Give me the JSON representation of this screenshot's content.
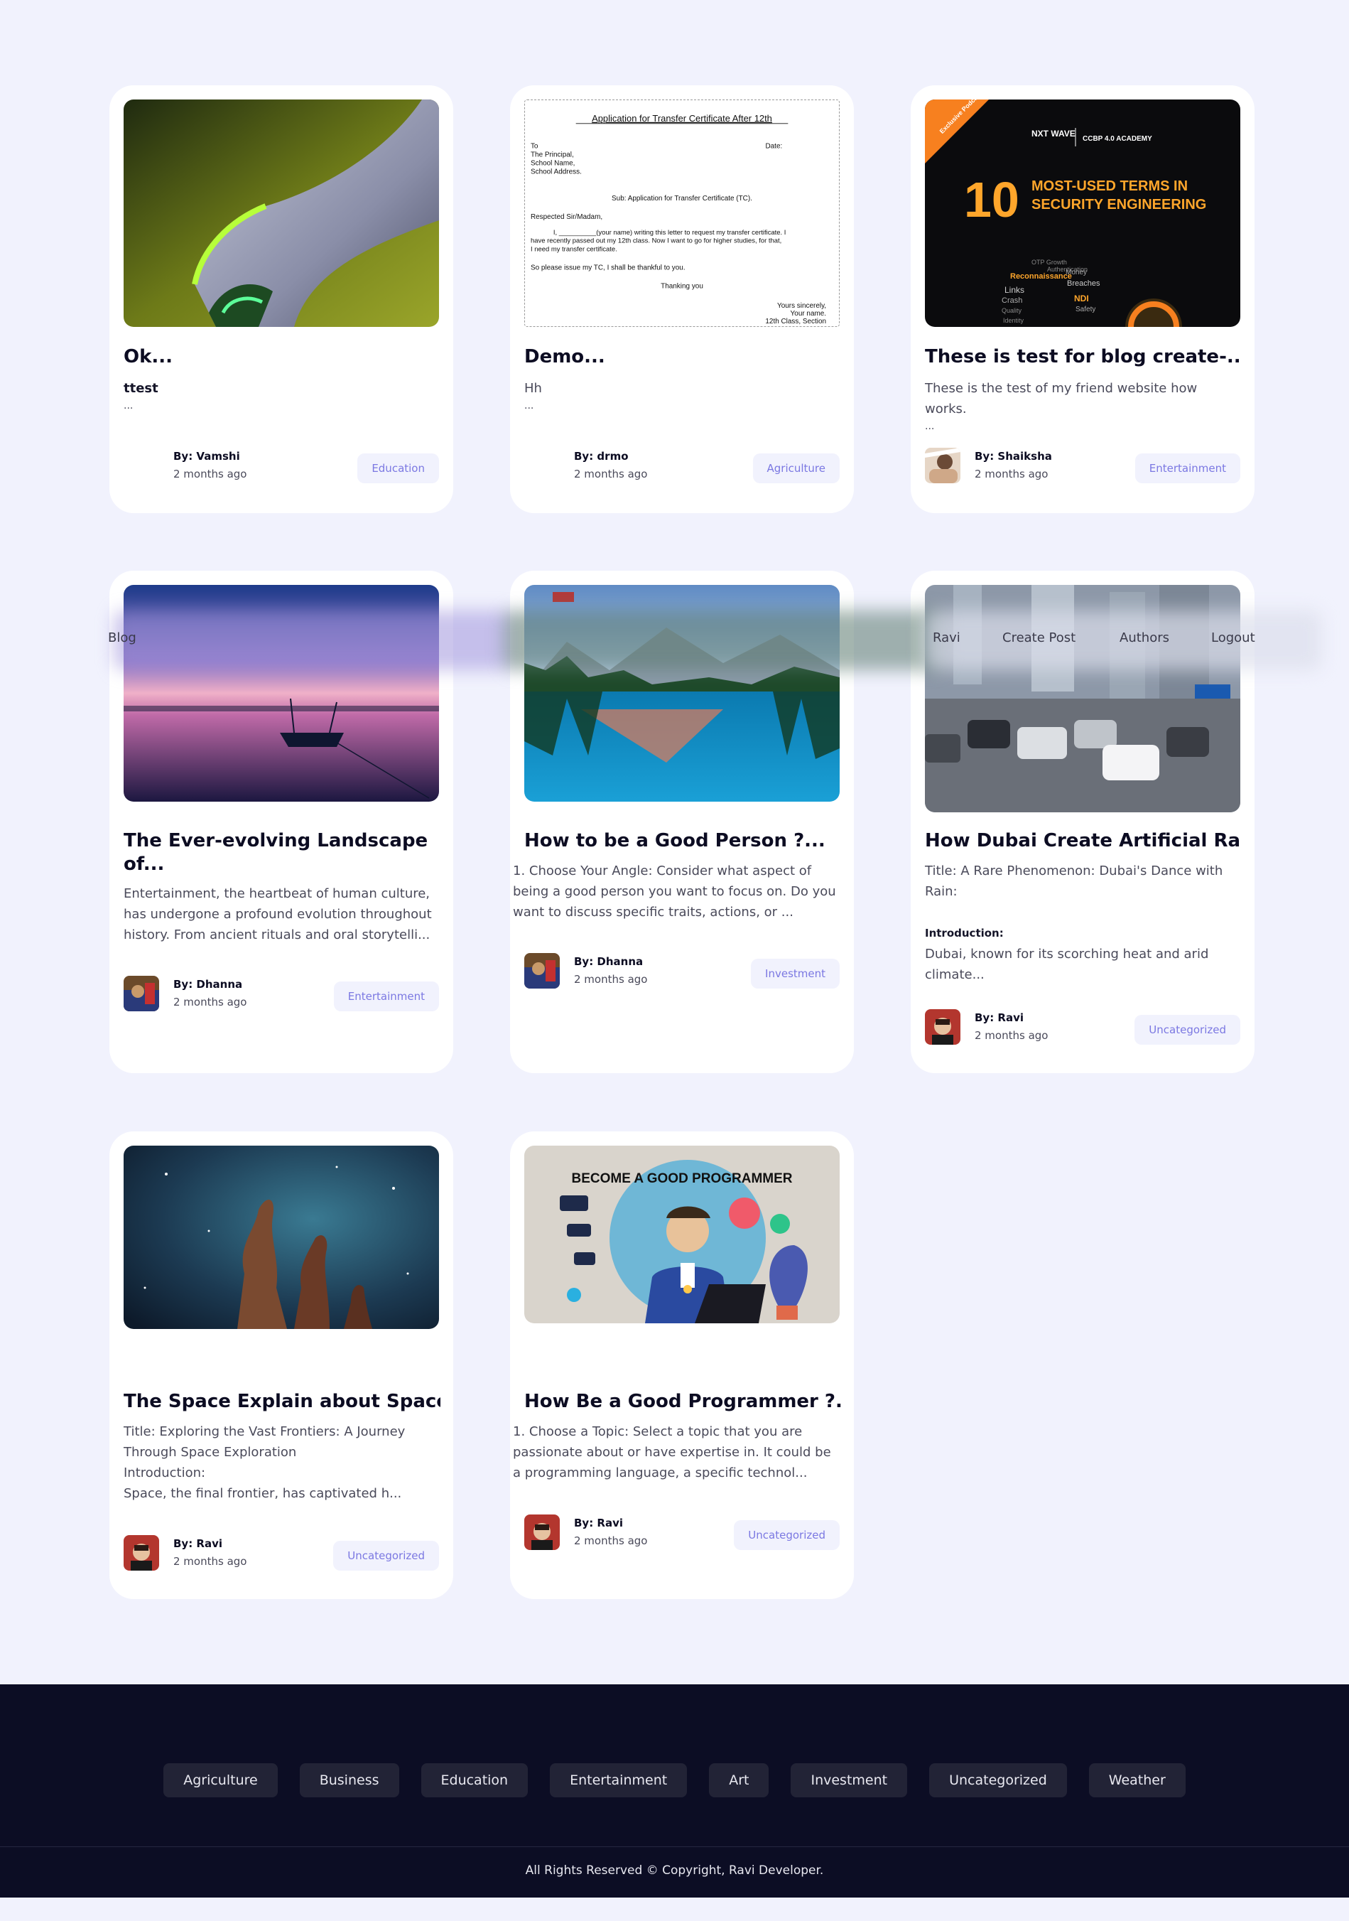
{
  "nav": {
    "left_link": "Blog",
    "links": [
      "Ravi",
      "Create Post",
      "Authors",
      "Logout"
    ]
  },
  "posts": [
    {
      "title": "Ok...",
      "excerpt_lines": [
        {
          "text": "ttest",
          "strong": true
        }
      ],
      "ellipsis": "...",
      "author": "By: Vamshi",
      "time": "2 months ago",
      "category": "Education",
      "image": "abstract-closeup-photo",
      "avatar": "none"
    },
    {
      "title": "Demo...",
      "excerpt_lines": [
        {
          "text": "Hh",
          "strong": false
        }
      ],
      "ellipsis": "...",
      "author": "By: drmo",
      "time": "2 months ago",
      "category": "Agriculture",
      "image": "transfer-certificate-letter",
      "avatar": "none",
      "letter": {
        "heading": "Application for Transfer Certificate After 12th",
        "lines": [
          "To",
          "The Principal,",
          "School Name,",
          "School Address.",
          "Sub: Application for Transfer Certificate (TC).",
          "Respected Sir/Madam,",
          "I, __________(your name) writing this letter to request my transfer certificate. I",
          "have recently passed out my 12th class. Now I want to go for higher studies, for that,",
          "I need my transfer certificate.",
          "So please issue my TC, I shall be thankful to you.",
          "Thanking you",
          "Yours sincerely,",
          "Your name.",
          "12th Class, Section"
        ],
        "date_label": "Date:"
      }
    },
    {
      "title": "These is test for blog create-...",
      "excerpt_lines": [
        {
          "text": "These is the test of my friend website how works.",
          "strong": false
        }
      ],
      "ellipsis": "...",
      "author": "By: Shaiksha",
      "time": "2 months ago",
      "category": "Entertainment",
      "image": "security-terms-poster",
      "avatar": "photo",
      "poster": {
        "ribbon": "Exclusive Podcast",
        "brand1": "NXT WAVE",
        "brand2": "CCBP 4.0 ACADEMY",
        "number": "10",
        "headline1": "MOST-USED TERMS IN",
        "headline2": "SECURITY ENGINEERING",
        "words": [
          "OTP Growth",
          "Authentication",
          "Reconnaissance",
          "Money",
          "Breaches",
          "Links",
          "Crash",
          "NDI",
          "Safety",
          "Quality",
          "Identity"
        ]
      }
    },
    {
      "title": "The Ever-evolving Landscape of...",
      "excerpt_lines": [
        {
          "text": "Entertainment, the heartbeat of human culture, has undergone a profound evolution throughout history. From ancient rituals and oral storytelli...",
          "strong": false
        }
      ],
      "author": "By: Dhanna",
      "time": "2 months ago",
      "category": "Entertainment",
      "image": "sunset-boat-lake",
      "avatar": "photo"
    },
    {
      "title": "How to be a Good Person ?...",
      "excerpt_lines": [
        {
          "text": "1. Choose Your Angle: Consider what aspect of being a good person you want to focus on. Do you want to discuss specific traits, actions, or ...",
          "strong": false
        }
      ],
      "author": "By: Dhanna",
      "time": "2 months ago",
      "category": "Investment",
      "image": "mountain-lake-reflection",
      "avatar": "photo"
    },
    {
      "title": "How Dubai Create Artificial Ra...",
      "excerpt_lines": [
        {
          "text": "Title: A Rare Phenomenon: Dubai's Dance with Rain:",
          "strong": false
        },
        {
          "text": "Introduction:",
          "strong": true
        },
        {
          "text": "Dubai, known for its scorching heat and arid climate...",
          "strong": false
        }
      ],
      "author": "By: Ravi",
      "time": "2 months ago",
      "category": "Uncategorized",
      "image": "dubai-rainy-street",
      "avatar": "photo"
    },
    {
      "title": "The Space Explain about Space....",
      "excerpt_lines": [
        {
          "text": "Title: Exploring the Vast Frontiers: A Journey Through Space Exploration",
          "strong": false
        },
        {
          "text": "Introduction:",
          "strong": false
        },
        {
          "text": "Space, the final frontier, has captivated h...",
          "strong": false
        }
      ],
      "author": "By: Ravi",
      "time": "2 months ago",
      "category": "Uncategorized",
      "image": "pillars-of-creation-nebula",
      "avatar": "photo"
    },
    {
      "title": "How Be a Good Programmer ?...",
      "excerpt_lines": [
        {
          "text": "1. Choose a Topic: Select a topic that you are passionate about or have expertise in. It could be a programming language, a specific technol...",
          "strong": false
        }
      ],
      "author": "By: Ravi",
      "time": "2 months ago",
      "category": "Uncategorized",
      "image": "programmer-illustration",
      "avatar": "photo",
      "illustration_caption": "BECOME A GOOD PROGRAMMER"
    }
  ],
  "footer": {
    "categories": [
      "Agriculture",
      "Business",
      "Education",
      "Entertainment",
      "Art",
      "Investment",
      "Uncategorized",
      "Weather"
    ],
    "copyright": "All Rights Reserved © Copyright, Ravi Developer."
  },
  "colors": {
    "page_bg": "#f1f2fd",
    "card_bg": "#ffffff",
    "tag_text": "#7b78e2",
    "footer_bg": "#0c0d24",
    "footer_chip": "#222336"
  }
}
